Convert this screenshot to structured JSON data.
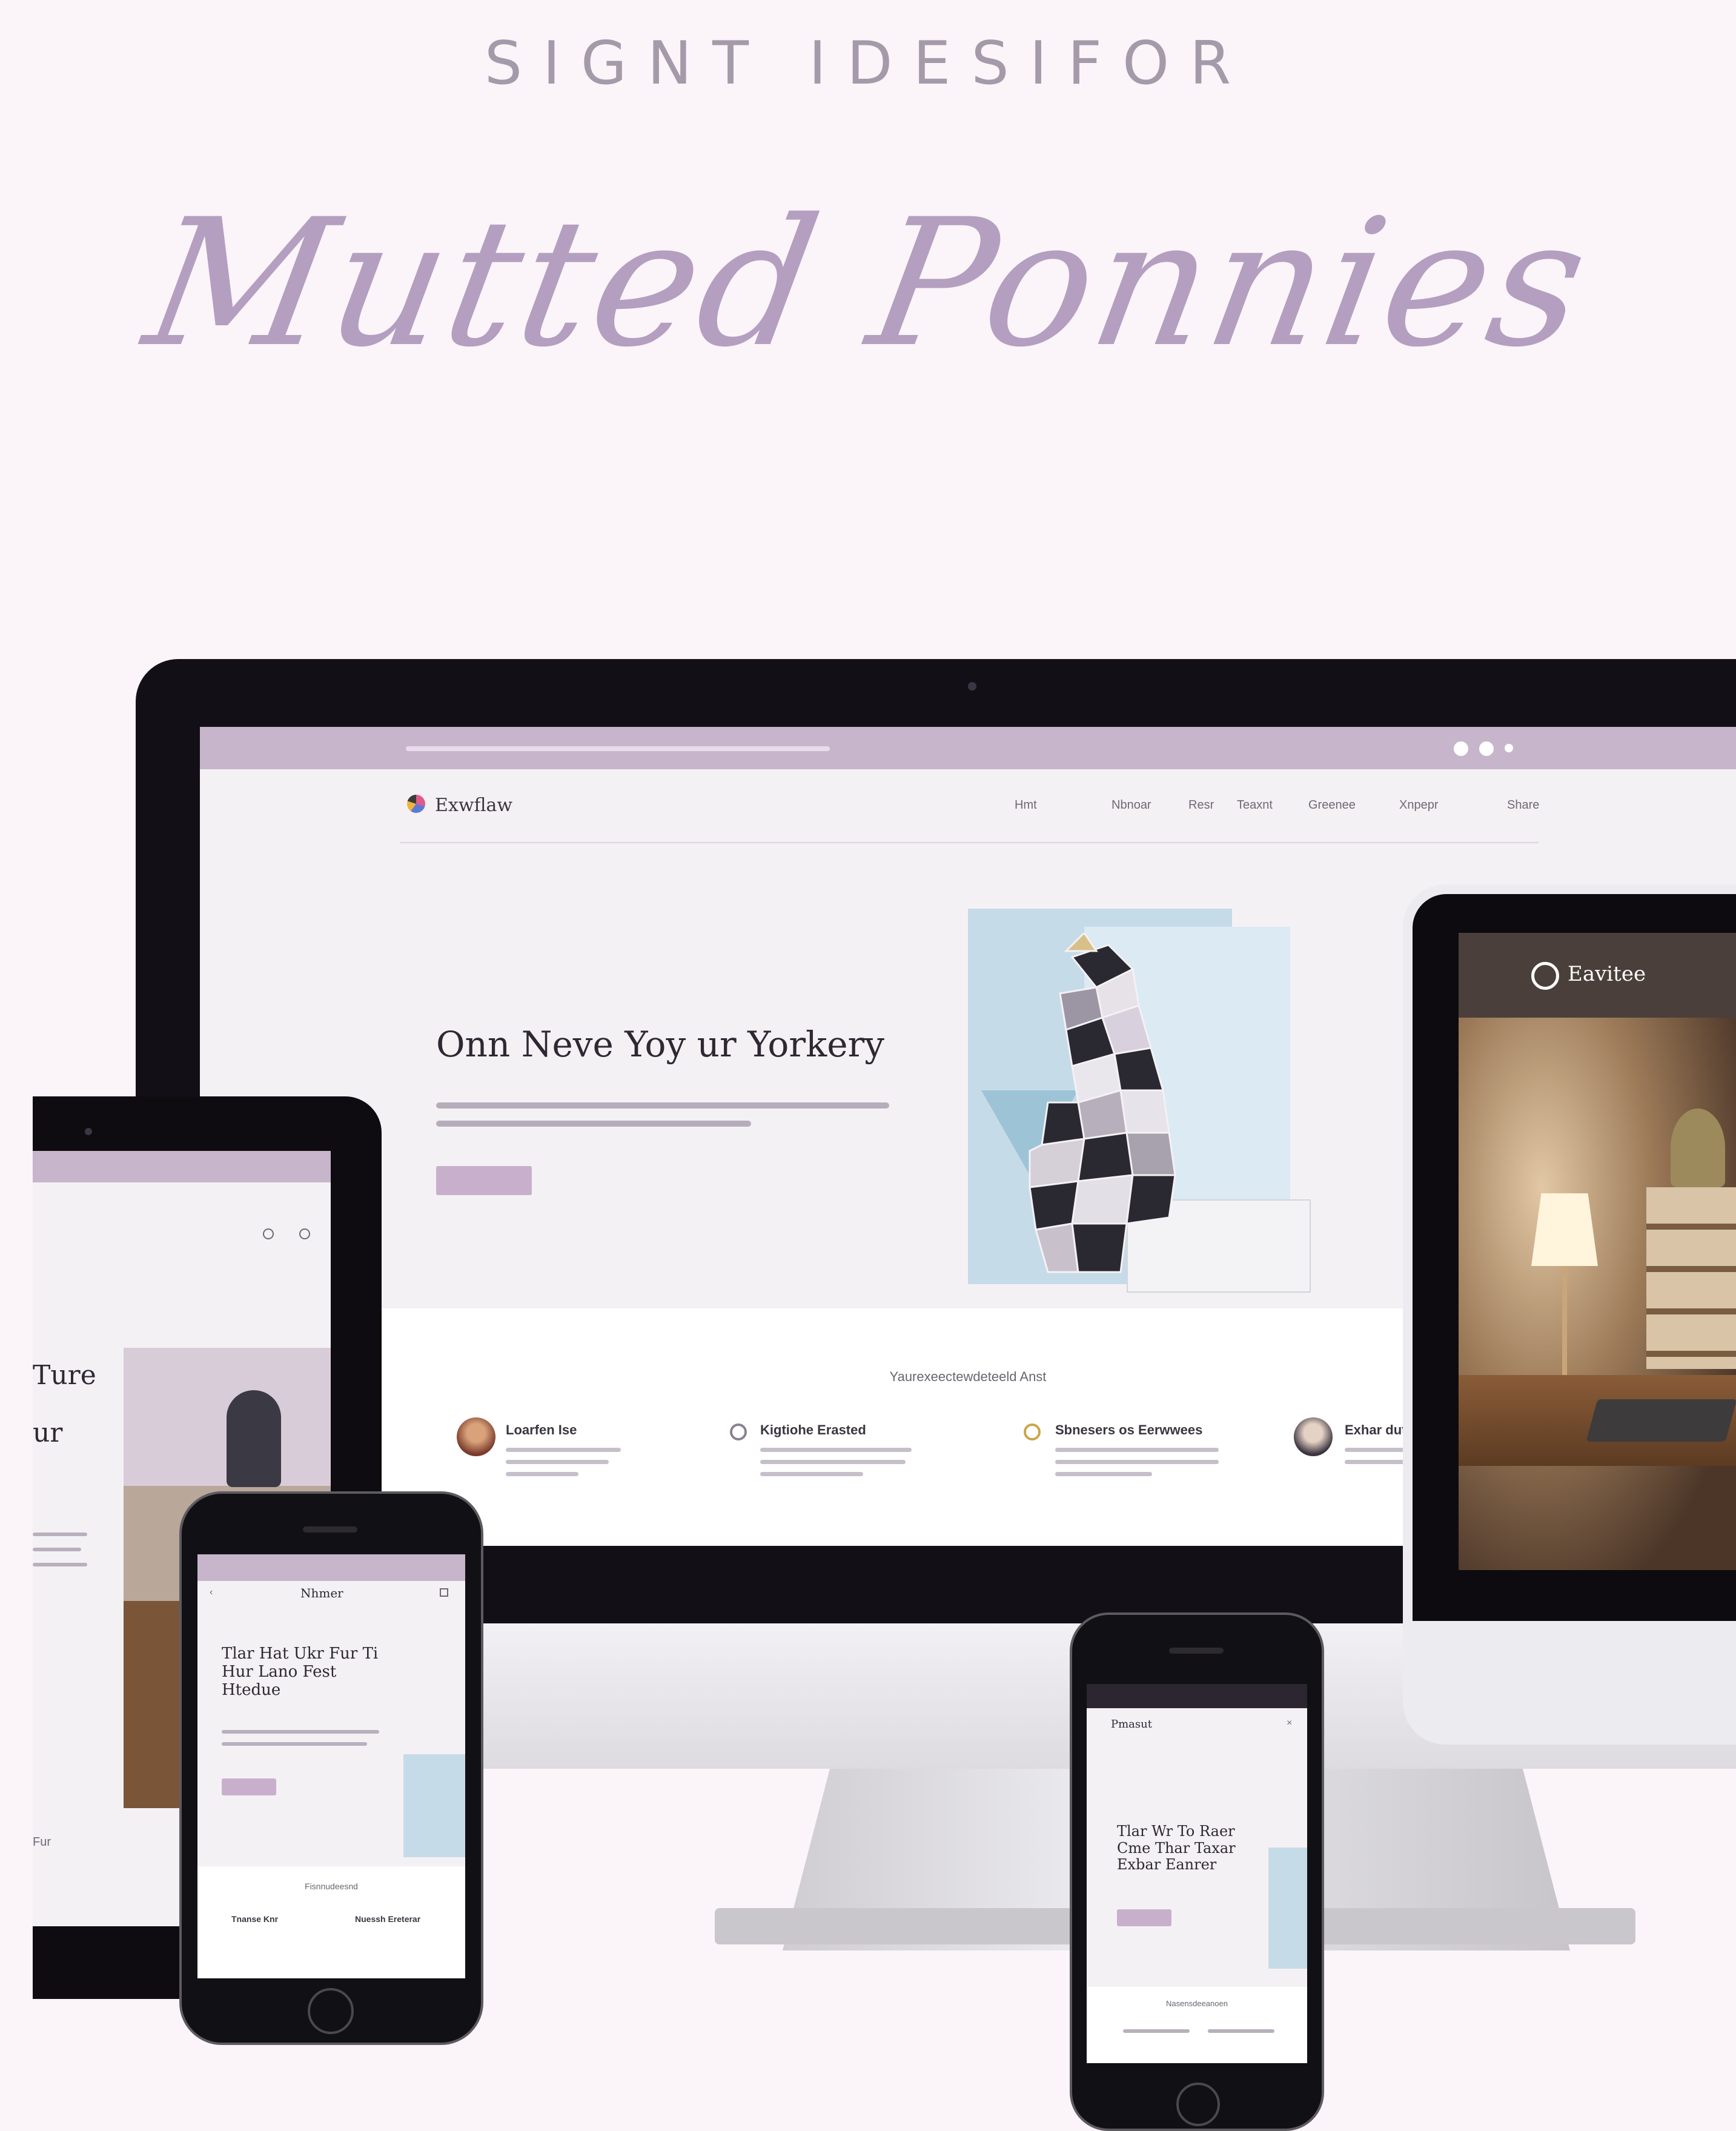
{
  "header": {
    "kicker": "SIGNT IDESIFOR",
    "script_title": "Mutted Ponnies"
  },
  "desktop": {
    "brand": "Exwflaw",
    "nav": [
      "Hmt",
      "Nbnoar",
      "Resr",
      "Teaxnt",
      "Greenee",
      "Xnpepr",
      "Share"
    ],
    "hero_title": "Onn Neve Yoy ur Yorkery",
    "features_heading": "Yaurexeectewdeteeld Anst",
    "features": [
      {
        "title": "Loarfen Ise"
      },
      {
        "title": "Kigtiohe Erasted"
      },
      {
        "title": "Sbnesers os Eerwwees"
      },
      {
        "title": "Exhar dut"
      }
    ]
  },
  "tablet_right": {
    "brand": "Eavitee"
  },
  "tablet_left": {
    "text_1": "Ture",
    "text_2": "ur",
    "footer": "Fur"
  },
  "phone_left": {
    "brand": "Nhmer",
    "hero_title": "Tlar Hat Ukr Fur Ti Hur Lano Fest Htedue",
    "section_heading": "Fisnnudeesnd",
    "features": [
      "Tnanse Knr",
      "Nuessh Ereterar"
    ]
  },
  "phone_right": {
    "brand": "Pmasut",
    "hero_title": "Tlar Wr To Raer Cme Thar Taxar Exbar Eanrer",
    "section_heading": "Nasensdeeanoen"
  },
  "colors": {
    "accent": "#c8b0cc",
    "background": "#fbf4f9",
    "script": "#b49fc0"
  }
}
